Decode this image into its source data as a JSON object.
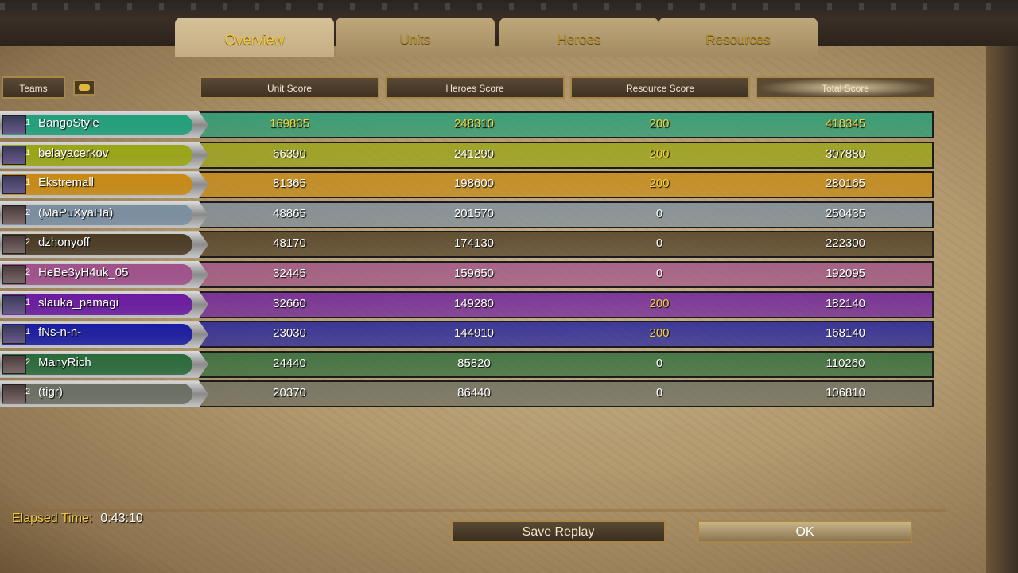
{
  "tabs": [
    {
      "label": "Overview",
      "active": true
    },
    {
      "label": "Units",
      "active": false
    },
    {
      "label": "Heroes",
      "active": false
    },
    {
      "label": "Resources",
      "active": false
    }
  ],
  "headers": {
    "teams": "Teams",
    "unit": "Unit Score",
    "heroes": "Heroes Score",
    "resource": "Resource Score",
    "total": "Total Score"
  },
  "players": [
    {
      "name": "BangoStyle",
      "team": "1",
      "color": "#1fa07a",
      "unit": "169835",
      "heroes": "248310",
      "resource": "200",
      "total": "418345",
      "gold": true
    },
    {
      "name": "belayacerkov",
      "team": "1",
      "color": "#9aa614",
      "unit": "66390",
      "heroes": "241290",
      "resource": "200",
      "total": "307880",
      "gold": false
    },
    {
      "name": "Ekstremall",
      "team": "1",
      "color": "#c88a12",
      "unit": "81365",
      "heroes": "198600",
      "resource": "200",
      "total": "280165",
      "gold": false
    },
    {
      "name": "(MaPuXyaHa)",
      "team": "2",
      "color": "#7a8ea0",
      "unit": "48865",
      "heroes": "201570",
      "resource": "0",
      "total": "250435",
      "gold": false
    },
    {
      "name": "dzhonyoff",
      "team": "2",
      "color": "#4a3a22",
      "unit": "48170",
      "heroes": "174130",
      "resource": "0",
      "total": "222300",
      "gold": false
    },
    {
      "name": "HeBe3yH4uk_05",
      "team": "2",
      "color": "#a0508a",
      "unit": "32445",
      "heroes": "159650",
      "resource": "0",
      "total": "192095",
      "gold": false
    },
    {
      "name": "slauka_pamagi",
      "team": "1",
      "color": "#6a1aa0",
      "unit": "32660",
      "heroes": "149280",
      "resource": "200",
      "total": "182140",
      "gold": false
    },
    {
      "name": "fNs-n-n-",
      "team": "1",
      "color": "#1a1ca0",
      "unit": "23030",
      "heroes": "144910",
      "resource": "200",
      "total": "168140",
      "gold": false
    },
    {
      "name": "ManyRich",
      "team": "2",
      "color": "#2a6a3a",
      "unit": "24440",
      "heroes": "85820",
      "resource": "0",
      "total": "110260",
      "gold": false
    },
    {
      "name": "(tigr)",
      "team": "2",
      "color": "#6a6e62",
      "unit": "20370",
      "heroes": "86440",
      "resource": "0",
      "total": "106810",
      "gold": false
    }
  ],
  "elapsed": {
    "label": "Elapsed Time:",
    "value": "0:43:10"
  },
  "buttons": {
    "save": "Save Replay",
    "ok": "OK"
  },
  "icons": {
    "header": "gold-coin-icon"
  }
}
